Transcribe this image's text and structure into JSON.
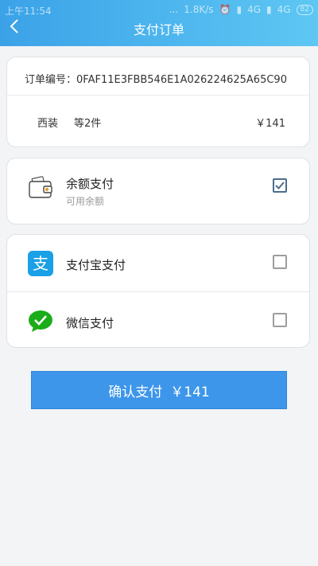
{
  "status_bar": {
    "time": "上午11:54",
    "dots": "...",
    "speed": "1.8K/s",
    "network1": "4G",
    "network2": "4G",
    "battery": "82"
  },
  "header": {
    "title": "支付订单"
  },
  "order": {
    "id_label": "订单编号：",
    "id_value": "0FAF11E3FBB546E1A026224625A65C90",
    "goods_name": "西装",
    "goods_count": "等2件",
    "goods_price": "￥141"
  },
  "payment": {
    "balance": {
      "label": "余额支付",
      "sub": "可用余额",
      "checked": true,
      "icon": "wallet-icon"
    },
    "alipay": {
      "label": "支付宝支付",
      "checked": false,
      "icon": "alipay-icon"
    },
    "wechat": {
      "label": "微信支付",
      "checked": false,
      "icon": "wechat-pay-icon"
    }
  },
  "confirm": {
    "label": "确认支付",
    "amount": "￥141"
  },
  "colors": {
    "header_start": "#3ba2e8",
    "header_end": "#5ec7f3",
    "button": "#3d96ea",
    "alipay": "#1aa0e6",
    "wechat": "#1aad19",
    "checkbox_checked": "#4a6d8c"
  }
}
